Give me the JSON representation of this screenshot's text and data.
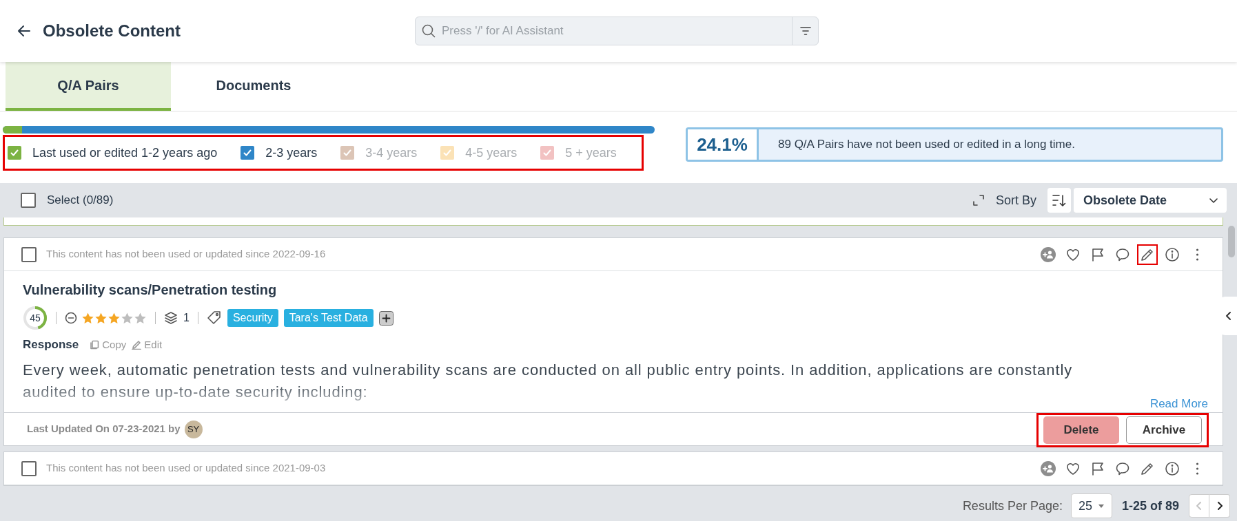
{
  "header": {
    "title": "Obsolete Content",
    "search": {
      "placeholder": "Press '/' for AI Assistant"
    }
  },
  "tabs": [
    {
      "label": "Q/A Pairs",
      "selected": true
    },
    {
      "label": "Documents",
      "selected": false
    }
  ],
  "age_bar": {
    "level": 0.03
  },
  "age_filters": {
    "highlighted": true,
    "items": [
      {
        "label": "Last used or edited 1-2 years ago",
        "color": "#7cb342",
        "checked": true,
        "disabled": false
      },
      {
        "label": "2-3 years",
        "color": "#2f86c8",
        "checked": true,
        "disabled": false
      },
      {
        "label": "3-4 years",
        "color": "#dcc5b6",
        "checked": true,
        "disabled": true
      },
      {
        "label": "4-5 years",
        "color": "#fbe2b6",
        "checked": true,
        "disabled": true
      },
      {
        "label": "5 + years",
        "color": "#f2c2c2",
        "checked": true,
        "disabled": true
      }
    ]
  },
  "summary": {
    "percent": "24.1%",
    "message": "89 Q/A Pairs have not been used or edited in a long time."
  },
  "toolbar": {
    "select": {
      "label": "Select (0/89)",
      "checked": false
    },
    "sort_label": "Sort By",
    "sort_value": "Obsolete Date"
  },
  "cards": [
    {
      "checked": false,
      "notice": "This content has not been used or updated since 2022-09-16",
      "actions": [
        {
          "kind": "assign",
          "highlighted": false
        },
        {
          "kind": "favorite",
          "highlighted": false
        },
        {
          "kind": "flag",
          "highlighted": false
        },
        {
          "kind": "comment",
          "highlighted": false
        },
        {
          "kind": "edit",
          "highlighted": true
        },
        {
          "kind": "info",
          "highlighted": false
        },
        {
          "kind": "more",
          "highlighted": false
        }
      ],
      "title": "Vulnerability scans/Penetration testing",
      "score": {
        "value": "45",
        "level": 0.45
      },
      "stars": 3,
      "versions": "1",
      "tags": [
        {
          "label": "Security",
          "color": "#29b0e0"
        },
        {
          "label": "Tara's Test Data",
          "color": "#29b0e0"
        }
      ],
      "response_label": "Response",
      "copy_label": "Copy",
      "edit_label": "Edit",
      "text": "Every week, automatic penetration tests and vulnerability scans are conducted on all public entry points. In addition, applications are constantly audited to ensure up-to-date security including:",
      "read_more": "Read More",
      "updated": "Last Updated On 07-23-2021 by",
      "avatar": "SY",
      "buttons_highlighted": true,
      "delete_label": "Delete",
      "archive_label": "Archive"
    },
    {
      "checked": false,
      "notice": "This content has not been used or updated since 2021-09-03",
      "actions": [
        {
          "kind": "assign",
          "highlighted": false
        },
        {
          "kind": "favorite",
          "highlighted": false
        },
        {
          "kind": "flag",
          "highlighted": false
        },
        {
          "kind": "comment",
          "highlighted": false
        },
        {
          "kind": "edit",
          "highlighted": false
        },
        {
          "kind": "info",
          "highlighted": false
        },
        {
          "kind": "more",
          "highlighted": false
        }
      ]
    }
  ],
  "pagination": {
    "label": "Results Per Page:",
    "per_page": "25",
    "range": "1-25 of 89",
    "prev_disabled": true,
    "next_disabled": false
  }
}
